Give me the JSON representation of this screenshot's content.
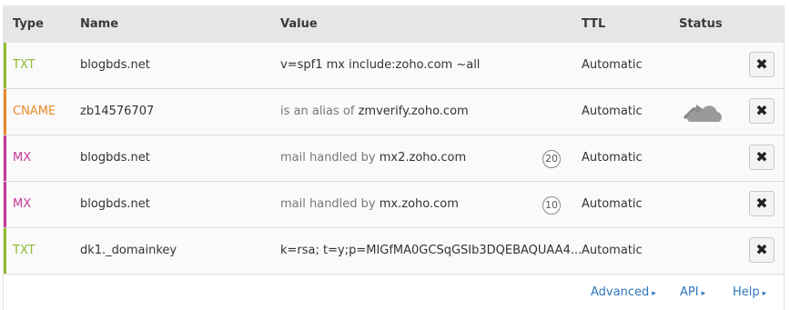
{
  "headers": {
    "type": "Type",
    "name": "Name",
    "value": "Value",
    "ttl": "TTL",
    "status": "Status"
  },
  "rows": [
    {
      "type": "TXT",
      "type_color": "#8dbb2f",
      "name": "blogbds.net",
      "value_prefix": "",
      "value": "v=spf1 mx include:zoho.com ~all",
      "priority": "",
      "ttl": "Automatic",
      "status_icon": "",
      "delete": "✖"
    },
    {
      "type": "CNAME",
      "type_color": "#e98a2b",
      "name": "zb14576707",
      "value_prefix": "is an alias of ",
      "value": "zmverify.zoho.com",
      "priority": "",
      "ttl": "Automatic",
      "status_icon": "cloud-bypass-icon",
      "delete": "✖"
    },
    {
      "type": "MX",
      "type_color": "#c53a97",
      "name": "blogbds.net",
      "value_prefix": "mail handled by ",
      "value": "mx2.zoho.com",
      "priority": "20",
      "ttl": "Automatic",
      "status_icon": "",
      "delete": "✖"
    },
    {
      "type": "MX",
      "type_color": "#c53a97",
      "name": "blogbds.net",
      "value_prefix": "mail handled by ",
      "value": "mx.zoho.com",
      "priority": "10",
      "ttl": "Automatic",
      "status_icon": "",
      "delete": "✖"
    },
    {
      "type": "TXT",
      "type_color": "#8dbb2f",
      "name": "dk1._domainkey",
      "value_prefix": "",
      "value": "k=rsa; t=y;p=MIGfMA0GCSqGSIb3DQEBAQUAA4...",
      "priority": "",
      "ttl": "Automatic",
      "status_icon": "",
      "delete": "✖"
    }
  ],
  "footer": {
    "advanced": "Advanced",
    "api": "API",
    "help": "Help",
    "chevron": "▸"
  },
  "colors": {
    "link": "#2f77ba",
    "header_bg": "#e6e6e6"
  }
}
